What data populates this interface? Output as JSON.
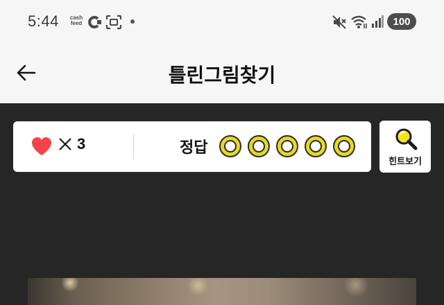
{
  "status_bar": {
    "time": "5:44",
    "cashfeed_line1": "cash",
    "cashfeed_line2": "feed",
    "battery": "100"
  },
  "header": {
    "title": "틀린그림찾기"
  },
  "game": {
    "lives_count": "3",
    "answer_label": "정답",
    "answer_slots": 5,
    "hint_label": "힌트보기"
  },
  "colors": {
    "heart": "#f2444a",
    "answer_ring": "#e8d81e",
    "game_background": "#262626",
    "header_background": "#f6f6f6"
  },
  "icons": [
    "back-arrow-icon",
    "heart-icon",
    "times-icon",
    "magnifier-icon",
    "mute-icon",
    "wifi-icon",
    "signal-icon"
  ]
}
